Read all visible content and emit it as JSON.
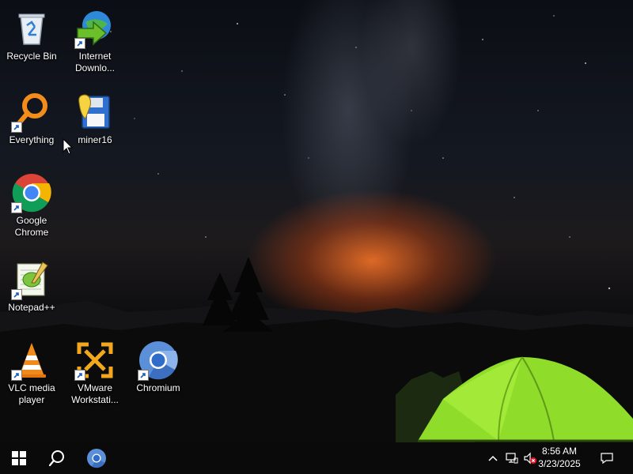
{
  "desktop": {
    "icons": [
      {
        "label": "Recycle Bin",
        "icon": "recycle-bin-icon",
        "shortcut": false
      },
      {
        "label": "Internet\nDownlo...",
        "icon": "internet-download-manager-icon",
        "shortcut": true
      },
      {
        "label": "Everything",
        "icon": "everything-search-icon",
        "shortcut": true
      },
      {
        "label": "miner16",
        "icon": "miner16-icon",
        "shortcut": false
      },
      {
        "label": "Google\nChrome",
        "icon": "google-chrome-icon",
        "shortcut": true
      },
      {
        "label": "Notepad++",
        "icon": "notepad-plus-plus-icon",
        "shortcut": true
      },
      {
        "label": "VLC media\nplayer",
        "icon": "vlc-icon",
        "shortcut": true
      },
      {
        "label": "VMware\nWorkstati...",
        "icon": "vmware-workstation-icon",
        "shortcut": true
      },
      {
        "label": "Chromium",
        "icon": "chromium-icon",
        "shortcut": true
      }
    ]
  },
  "taskbar": {
    "start": "windows-logo-icon",
    "search": "search-icon",
    "pinned": [
      "chromium-icon"
    ],
    "tray": {
      "icons": [
        "chevron-up-icon",
        "network-icon",
        "volume-muted-icon",
        "notification-icon"
      ],
      "time": "8:56 AM",
      "date": "3/23/2025"
    }
  },
  "colors": {
    "taskbar": "#0a0a0a",
    "tent": "#8fdc2a",
    "horizon_glow": "#ff7828"
  }
}
